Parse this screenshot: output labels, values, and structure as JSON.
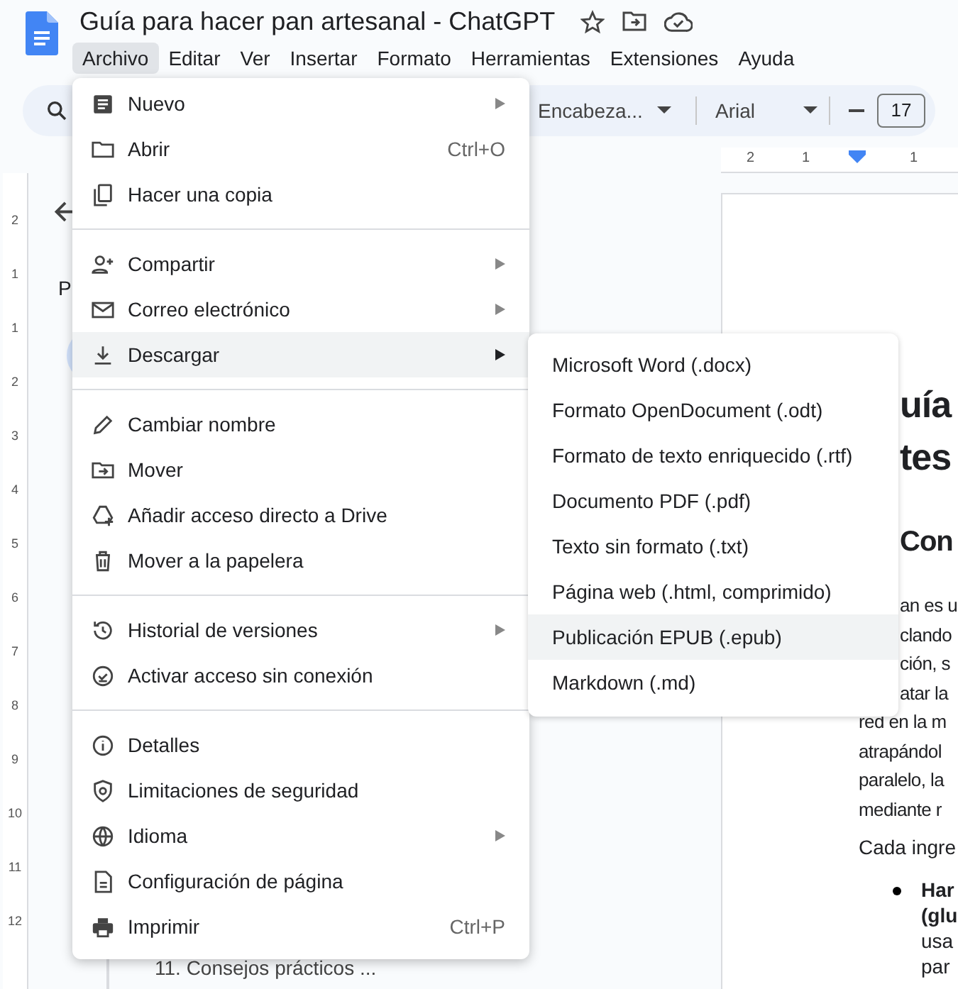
{
  "window": {
    "title": "Guía para hacer pan artesanal - ChatGPT"
  },
  "menu_bar": [
    {
      "label": "Archivo",
      "selected": true
    },
    {
      "label": "Editar",
      "selected": false
    },
    {
      "label": "Ver",
      "selected": false
    },
    {
      "label": "Insertar",
      "selected": false
    },
    {
      "label": "Formato",
      "selected": false
    },
    {
      "label": "Herramientas",
      "selected": false
    },
    {
      "label": "Extensiones",
      "selected": false
    },
    {
      "label": "Ayuda",
      "selected": false
    }
  ],
  "toolbar": {
    "style_dropdown": "Encabeza...",
    "font_dropdown": "Arial",
    "font_size": "17"
  },
  "ruler": {
    "horizontal_numbers": [
      "2",
      "1",
      "1"
    ],
    "vertical_numbers": [
      "2",
      "1",
      "1",
      "2",
      "3",
      "4",
      "5",
      "6",
      "7",
      "8",
      "9",
      "10",
      "11",
      "12"
    ]
  },
  "outline": {
    "heading": "P",
    "item": "11. Consejos prácticos ..."
  },
  "document": {
    "title_lines": [
      "uía",
      "tes"
    ],
    "section_heading": "Con",
    "paragraph_lines": [
      {
        "kind": "cut",
        "text": "an es u"
      },
      {
        "kind": "cut",
        "text": "clando"
      },
      {
        "kind": "cut",
        "text": "ción, s"
      },
      {
        "kind": "cut",
        "text": "atar la"
      },
      {
        "kind": "line",
        "text": "red en la m"
      },
      {
        "kind": "line",
        "text": "atrapándol"
      },
      {
        "kind": "line",
        "text": "paralelo, la"
      },
      {
        "kind": "line",
        "text": "mediante r"
      }
    ],
    "paragraph_2": "Cada ingre",
    "bullet": {
      "bold_lines": [
        "Har",
        "(glu"
      ],
      "lines": [
        "usa",
        "par"
      ]
    }
  },
  "file_menu": [
    [
      {
        "label": "Nuevo",
        "submenu": true,
        "selected": false
      },
      {
        "label": "Abrir",
        "shortcut": "Ctrl+O",
        "submenu": false,
        "selected": false
      },
      {
        "label": "Hacer una copia",
        "submenu": false,
        "selected": false
      }
    ],
    [
      {
        "label": "Compartir",
        "submenu": true,
        "selected": false
      },
      {
        "label": "Correo electrónico",
        "submenu": true,
        "selected": false
      },
      {
        "label": "Descargar",
        "submenu": true,
        "selected": true
      }
    ],
    [
      {
        "label": "Cambiar nombre",
        "submenu": false,
        "selected": false
      },
      {
        "label": "Mover",
        "submenu": false,
        "selected": false
      },
      {
        "label": "Añadir acceso directo a Drive",
        "submenu": false,
        "selected": false
      },
      {
        "label": "Mover a la papelera",
        "submenu": false,
        "selected": false
      }
    ],
    [
      {
        "label": "Historial de versiones",
        "submenu": true,
        "selected": false
      },
      {
        "label": "Activar acceso sin conexión",
        "submenu": false,
        "selected": false
      }
    ],
    [
      {
        "label": "Detalles",
        "submenu": false,
        "selected": false
      },
      {
        "label": "Limitaciones de seguridad",
        "submenu": false,
        "selected": false
      },
      {
        "label": "Idioma",
        "submenu": true,
        "selected": false
      },
      {
        "label": "Configuración de página",
        "submenu": false,
        "selected": false
      },
      {
        "label": "Imprimir",
        "shortcut": "Ctrl+P",
        "submenu": false,
        "selected": false
      }
    ]
  ],
  "download_submenu": [
    {
      "label": "Microsoft Word (.docx)",
      "selected": false
    },
    {
      "label": "Formato OpenDocument (.odt)",
      "selected": false
    },
    {
      "label": "Formato de texto enriquecido (.rtf)",
      "selected": false
    },
    {
      "label": "Documento PDF (.pdf)",
      "selected": false
    },
    {
      "label": "Texto sin formato (.txt)",
      "selected": false
    },
    {
      "label": "Página web (.html, comprimido)",
      "selected": false
    },
    {
      "label": "Publicación EPUB (.epub)",
      "selected": true
    },
    {
      "label": "Markdown (.md)",
      "selected": false
    }
  ]
}
